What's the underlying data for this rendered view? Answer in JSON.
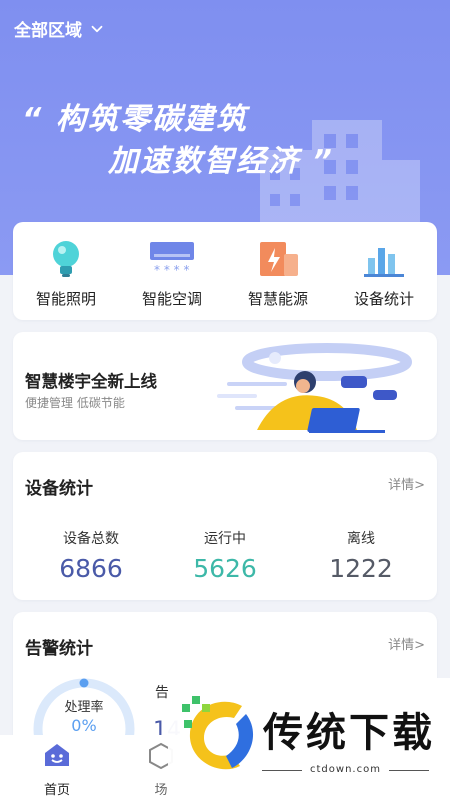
{
  "header": {
    "region_label": "全部区域",
    "slogan_line1": "“ 构筑零碳建筑",
    "slogan_line2": "加速数智经济 ”"
  },
  "quick_actions": [
    {
      "label": "智能照明",
      "icon": "bulb-icon"
    },
    {
      "label": "智能空调",
      "icon": "air-conditioner-icon"
    },
    {
      "label": "智慧能源",
      "icon": "energy-icon"
    },
    {
      "label": "设备统计",
      "icon": "bar-chart-icon"
    }
  ],
  "banner": {
    "title": "智慧楼宇全新上线",
    "subtitle": "便捷管理 低碳节能"
  },
  "device_stats": {
    "title": "设备统计",
    "detail_link": "详情>",
    "items": [
      {
        "label": "设备总数",
        "value": "6866",
        "color": "#4a5aa8"
      },
      {
        "label": "运行中",
        "value": "5626",
        "color": "#3db8a8"
      },
      {
        "label": "离线",
        "value": "1222",
        "color": "#555a66"
      }
    ]
  },
  "alarm_stats": {
    "title": "告警统计",
    "detail_link": "详情>",
    "gauge_label": "处理率",
    "gauge_value": "0%",
    "gauge_fraction": 0,
    "count_label_partial": "告",
    "count_value_partial": "14"
  },
  "tabbar": {
    "items": [
      {
        "label": "首页",
        "icon": "home-icon",
        "active": true
      },
      {
        "label": "场",
        "icon": "scene-icon",
        "active": false
      }
    ]
  },
  "watermark": {
    "text": "传统下载",
    "url": "ctdown.com"
  },
  "colors": {
    "hero": "#8190f0",
    "accent": "#4a5aa8",
    "running": "#3db8a8"
  }
}
